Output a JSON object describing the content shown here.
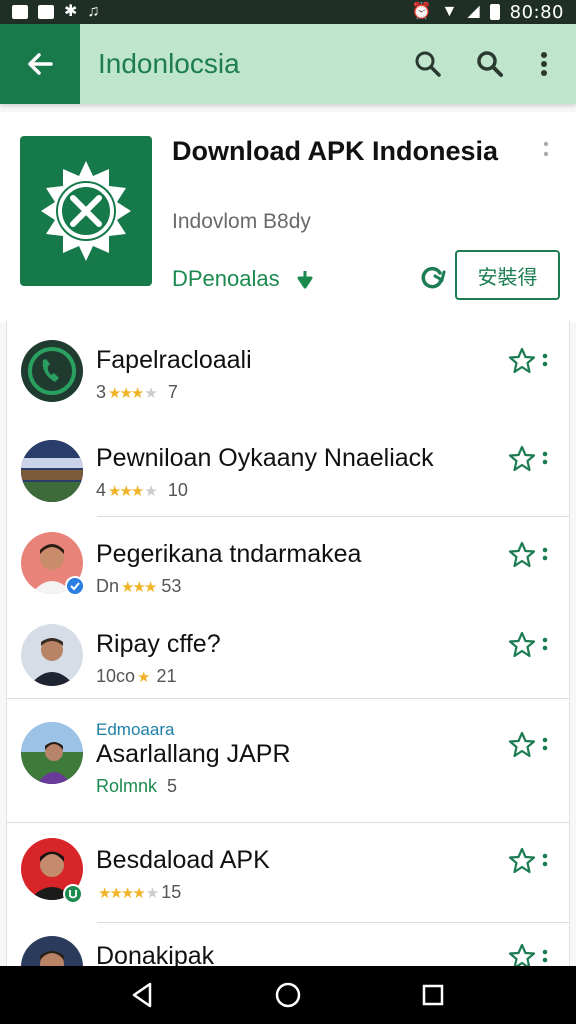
{
  "statusbar": {
    "time": "80:80"
  },
  "appbar": {
    "title": "Indonlocsia"
  },
  "header": {
    "title": "Download APK Indonesia",
    "subtitle": "Indovlom B8dy",
    "developer": "DPenoalas",
    "install_label": "安裝得"
  },
  "list": [
    {
      "name": "Fapelracloaali",
      "rating_prefix": "3",
      "rating_suffix": "7"
    },
    {
      "name": "Pewniloan Oykaany Nnaeliack",
      "rating_prefix": "4",
      "rating_suffix": "10"
    },
    {
      "name": "Pegerikana tndarmakea",
      "rating_prefix": "Dn",
      "rating_suffix": "53"
    },
    {
      "name": "Ripay cffe?",
      "rating_prefix": "10co",
      "rating_suffix": "21"
    },
    {
      "tag": "Edmoaara",
      "name": "Asarlallang JAPR",
      "rating_prefix": "Rolmnk",
      "rating_suffix": "5"
    },
    {
      "name": "Besdaload APK",
      "rating_prefix": "",
      "rating_suffix": "15"
    },
    {
      "name": "Donakipak"
    }
  ],
  "colors": {
    "brand": "#18794a",
    "appbar": "#bfe5cd",
    "accent": "#1c7c52",
    "star": "#f0b429"
  },
  "icons": [
    "back-arrow-icon",
    "search-icon",
    "more-vert-icon",
    "star-outline-icon",
    "refresh-icon",
    "nav-back-icon",
    "nav-home-icon",
    "nav-recents-icon"
  ]
}
